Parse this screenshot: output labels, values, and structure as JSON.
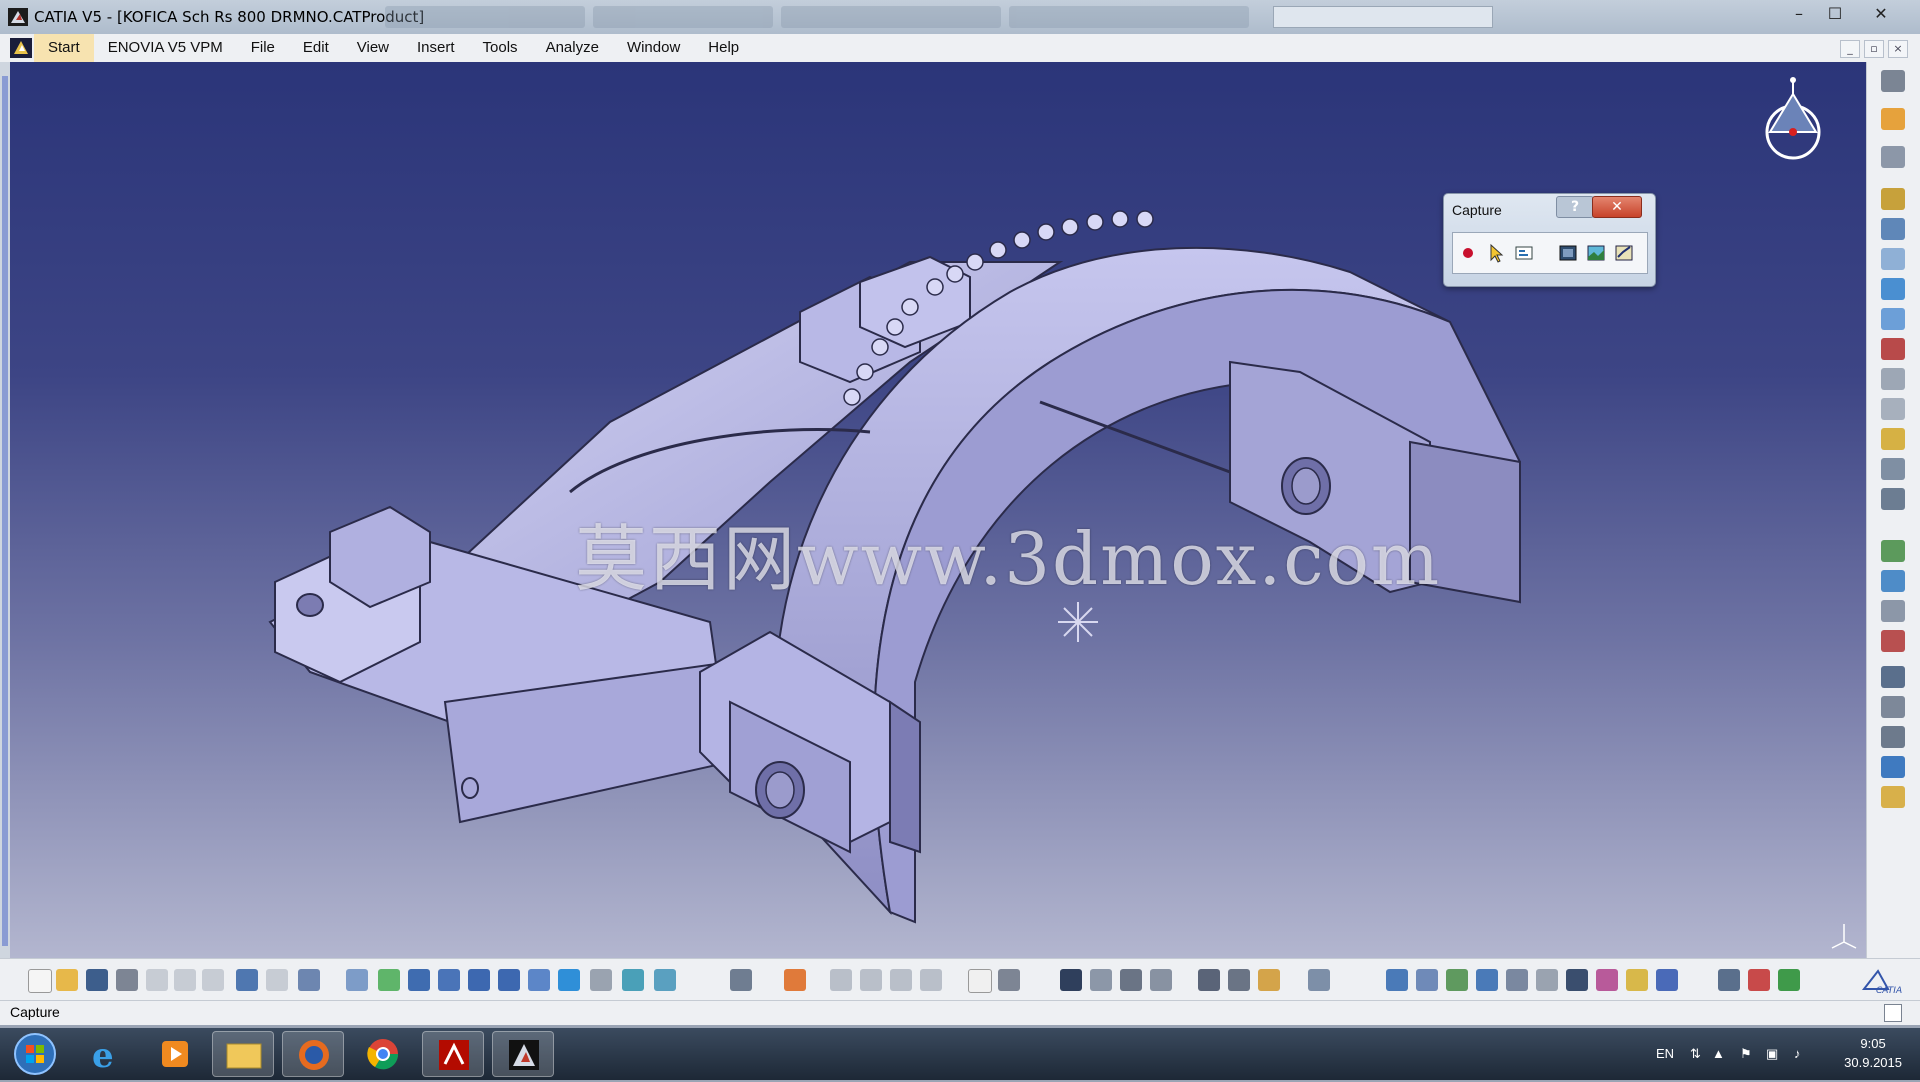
{
  "window": {
    "title": "CATIA V5 - [KOFICA Sch Rs 800 DRMNO.CATProduct]",
    "controls": [
      "–",
      "☐",
      "✕"
    ]
  },
  "menubar": {
    "items": [
      "Start",
      "ENOVIA V5 VPM",
      "File",
      "Edit",
      "View",
      "Insert",
      "Tools",
      "Analyze",
      "Window",
      "Help"
    ],
    "active": "Start",
    "doc_controls": [
      "_",
      "▫",
      "×"
    ]
  },
  "viewport": {
    "watermark": "莫西网www.3dmox.com",
    "model": "3D product assembly",
    "background_top": "#2b3579",
    "background_bottom": "#b3b6cf",
    "part_color": "#b8b8e8"
  },
  "capture_dialog": {
    "title": "Capture",
    "help_label": "?",
    "close_label": "✕",
    "tools": [
      "record-icon",
      "select-icon",
      "options-icon",
      "snapshot-icon",
      "image-icon",
      "album-icon"
    ]
  },
  "statusbar": {
    "text": "Capture"
  },
  "taskbar": {
    "apps": [
      "start-orb-icon",
      "internet-explorer-icon",
      "media-player-icon",
      "file-explorer-icon",
      "firefox-icon",
      "chrome-icon",
      "acrobat-icon",
      "catia-icon"
    ],
    "language": "EN",
    "time": "9:05",
    "date": "30.9.2015"
  },
  "colors": {
    "accent": "#f7e3b0",
    "toolbar_bg": "#eef0f3"
  }
}
